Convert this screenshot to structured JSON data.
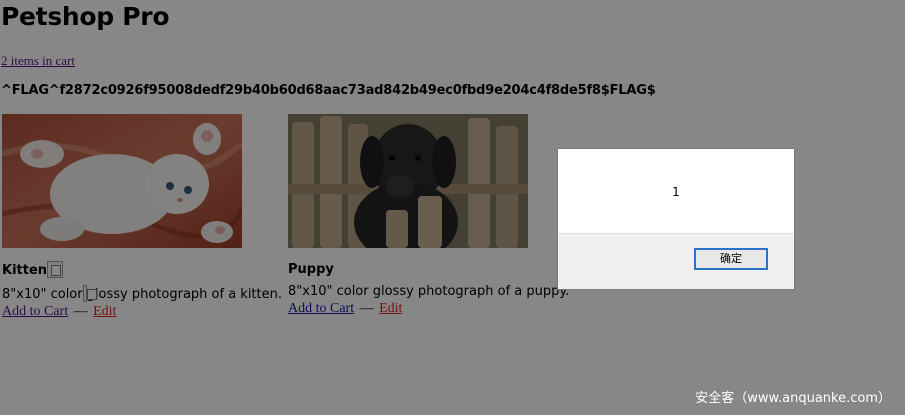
{
  "app": {
    "title": "Petshop Pro",
    "cart_link": "2 items in cart",
    "flag": "^FLAG^f2872c0926f95008dedf29b40b60d68aac73ad842b49ec0fbd9e204c4f8de5f8$FLAG$"
  },
  "products": [
    {
      "name": "Kitten",
      "desc_before": "8\"x10\" color ",
      "desc_after": "glossy photograph of a kitten.",
      "add_label": "Add to Cart",
      "separator": "—",
      "edit_label": "Edit",
      "image": "kitten-photo",
      "name_icon": "broken-image-icon",
      "desc_icon": "broken-image-icon"
    },
    {
      "name": "Puppy",
      "desc": "8\"x10\" color glossy photograph of a puppy.",
      "add_label": "Add to Cart",
      "separator": "—",
      "edit_label": "Edit",
      "image": "puppy-photo"
    }
  ],
  "dialog": {
    "message": "1",
    "ok_label": "确定"
  },
  "watermark": "安全客（www.anquanke.com）",
  "colors": {
    "overlay": "rgba(0,0,0,0.47)",
    "visited_link": "#551a8b",
    "link": "#1a1aa6",
    "edit_link": "#e02020",
    "button_focus": "#2b73c8"
  }
}
